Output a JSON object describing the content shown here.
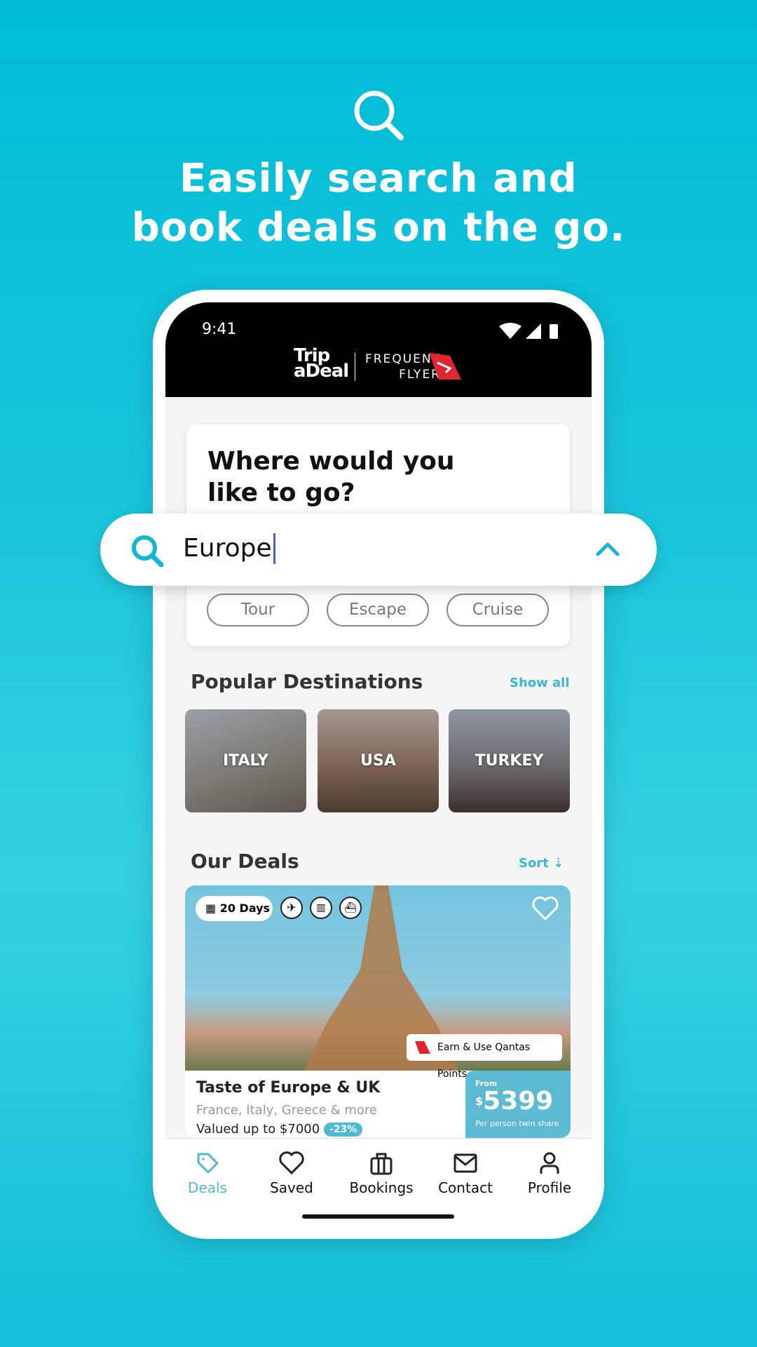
{
  "hero": {
    "icon": "search-icon",
    "line1": "Easily search and",
    "line2": "book deals on the go."
  },
  "status": {
    "time": "9:41"
  },
  "brand": {
    "logo_line1": "Trip",
    "logo_line2": "aDeal",
    "partner_line1": "FREQUENT",
    "partner_line2": "FLYER"
  },
  "search_card": {
    "question": "Where would you like to go?",
    "query": "Europe",
    "types": [
      "Tour",
      "Escape",
      "Cruise"
    ]
  },
  "popular": {
    "title": "Popular Destinations",
    "show_all": "Show all",
    "destinations": [
      "ITALY",
      "USA",
      "TURKEY"
    ]
  },
  "deals": {
    "title": "Our Deals",
    "sort": "Sort",
    "items": [
      {
        "duration": "20 Days",
        "badge": "Earn & Use Qantas Points",
        "title": "Taste of Europe & UK",
        "subtitle": "France, Italy, Greece & more",
        "valued": "Valued up to $7000",
        "discount": "-23%",
        "from": "From",
        "currency": "$",
        "price": "5399",
        "price_note": "Per person twin share"
      }
    ]
  },
  "nav": {
    "active": "Deals",
    "items": [
      "Deals",
      "Saved",
      "Bookings",
      "Contact",
      "Profile"
    ]
  },
  "colors": {
    "accent": "#3db6d0",
    "background": "#00bcd6",
    "qantas": "#e0262f"
  }
}
